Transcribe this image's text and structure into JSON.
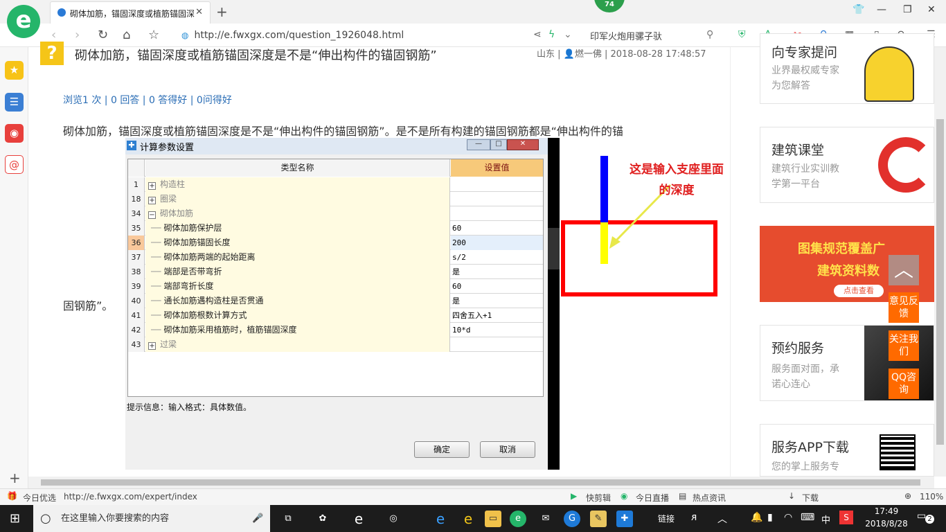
{
  "browser": {
    "logo_letter": "e",
    "tab_title": "砌体加筋，锚固深度或植筋锚固深度是不是“伸出构件的锚固钢筋”",
    "tab_close": "✕",
    "new_tab": "+",
    "badge": "74",
    "url": "http://e.fwxgx.com/question_1926048.html",
    "search_text": "印军火炮用骡子驮",
    "zoom": "110%"
  },
  "question": {
    "icon": "?",
    "title": "砌体加筋，锚固深度或植筋锚固深度是不是“伸出构件的锚固钢筋”",
    "meta": "山东 | 👤燃一佛 | 2018-08-28 17:48:57",
    "stats": "浏览1 次 | 0 回答 | 0 答得好 | 0问得好",
    "body_line1": "砌体加筋，锚固深度或植筋锚固深度是不是“伸出构件的锚固钢筋”。是不是所有构建的锚固钢筋都是“伸出构件的锚",
    "body_line2": "固钢筋”。"
  },
  "dialog": {
    "title": "计算参数设置",
    "col_name": "类型名称",
    "col_value": "设置值",
    "rows": [
      {
        "num": "1",
        "name": "构造柱",
        "value": "",
        "kind": "group",
        "toggle": "+"
      },
      {
        "num": "18",
        "name": "圈梁",
        "value": "",
        "kind": "group",
        "toggle": "+"
      },
      {
        "num": "34",
        "name": "砌体加筋",
        "value": "",
        "kind": "group",
        "toggle": "−"
      },
      {
        "num": "35",
        "name": "砌体加筋保护层",
        "value": "60",
        "kind": "item"
      },
      {
        "num": "36",
        "name": "砌体加筋锚固长度",
        "value": "200",
        "kind": "item",
        "selected": true
      },
      {
        "num": "37",
        "name": "砌体加筋两端的起始距离",
        "value": "s/2",
        "kind": "item"
      },
      {
        "num": "38",
        "name": "端部是否带弯折",
        "value": "是",
        "kind": "item"
      },
      {
        "num": "39",
        "name": "端部弯折长度",
        "value": "60",
        "kind": "item"
      },
      {
        "num": "40",
        "name": "通长加筋遇构造柱是否贯通",
        "value": "是",
        "kind": "item"
      },
      {
        "num": "41",
        "name": "砌体加筋根数计算方式",
        "value": "四舍五入+1",
        "kind": "item"
      },
      {
        "num": "42",
        "name": "砌体加筋采用植筋时，植筋锚固深度",
        "value": "10*d",
        "kind": "item"
      },
      {
        "num": "43",
        "name": "过梁",
        "value": "",
        "kind": "group",
        "toggle": "+"
      }
    ],
    "hint": "提示信息：输入格式：具体数值。",
    "ok": "确定",
    "cancel": "取消"
  },
  "annotation": {
    "line1": "这是输入支座里面",
    "line2": "的深度",
    "colors": {
      "text": "#e02020",
      "box": "#ff0000",
      "blue_bar": "#0000ff",
      "yellow_bar": "#ffff00",
      "arrow": "#e8e84a"
    }
  },
  "right": {
    "card1_title": "向专家提问",
    "card1_sub1": "业界最权威专家",
    "card1_sub2": "为您解答",
    "card2_title": "建筑课堂",
    "card2_sub1": "建筑行业实训教",
    "card2_sub2": "学第一平台",
    "banner_line1": "图集规范覆盖广",
    "banner_line2": "建筑资料数",
    "banner_btn": "点击查看",
    "card3_title": "预约服务",
    "card3_sub1": "服务面对面，承",
    "card3_sub2": "诺心连心",
    "card4_title": "服务APP下载",
    "card4_sub1": "您的掌上服务专",
    "float_feedback": "意见反馈",
    "float_follow": "关注我们",
    "float_qq": "QQ咨询"
  },
  "statusbar": {
    "news": "今日优选",
    "link": "http://e.fwxgx.com/expert/index",
    "kuaijian": "快剪辑",
    "live": "今日直播",
    "hot": "热点资讯",
    "download": "下载",
    "zoom": "110%"
  },
  "taskbar": {
    "search_placeholder": "在这里输入你要搜索的内容",
    "links": "链接",
    "ime": "中",
    "time": "17:49",
    "date": "2018/8/28",
    "notif": "2"
  }
}
